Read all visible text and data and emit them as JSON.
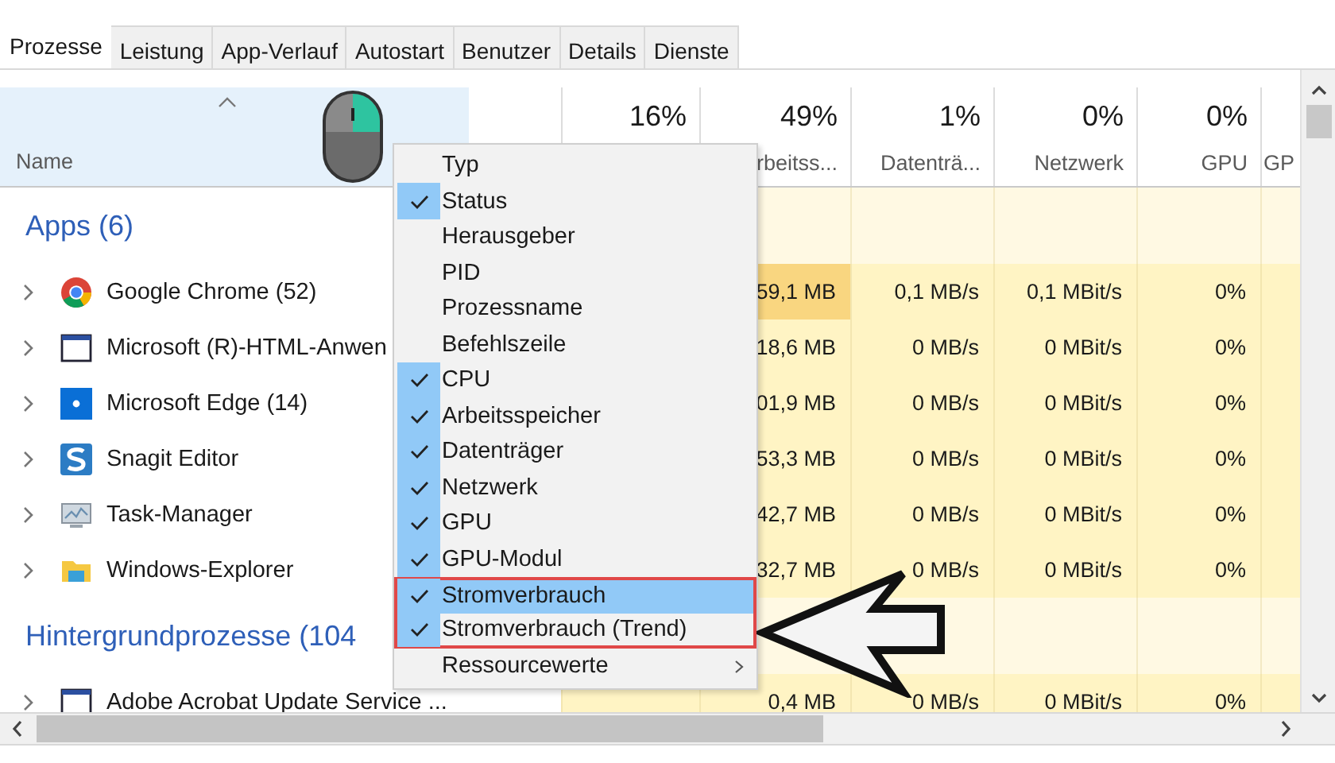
{
  "tabs": [
    {
      "label": "Prozesse",
      "selected": true
    },
    {
      "label": "Leistung",
      "selected": false
    },
    {
      "label": "App-Verlauf",
      "selected": false
    },
    {
      "label": "Autostart",
      "selected": false
    },
    {
      "label": "Benutzer",
      "selected": false
    },
    {
      "label": "Details",
      "selected": false
    },
    {
      "label": "Dienste",
      "selected": false
    }
  ],
  "table": {
    "name_column": {
      "label": "Name",
      "sorted": true
    },
    "columns": [
      {
        "percent": "16%"
      },
      {
        "percent": "49%",
        "label": "rbeitss..."
      },
      {
        "percent": "1%",
        "label": "Datenträ..."
      },
      {
        "percent": "0%",
        "label": "Netzwerk"
      },
      {
        "percent": "0%",
        "label": "GPU"
      },
      {
        "label": "GP"
      }
    ],
    "groups": [
      {
        "title": "Apps (6)",
        "rows": [
          {
            "kind": "chrome",
            "name": "Google Chrome (52)",
            "memory": "59,1 MB",
            "memory_high": true,
            "disk": "0,1 MB/s",
            "network": "0,1 MBit/s",
            "gpu": "0%"
          },
          {
            "kind": "window",
            "name": "Microsoft (R)-HTML-Anwen",
            "memory": "18,6 MB",
            "memory_high": false,
            "disk": "0 MB/s",
            "network": "0 MBit/s",
            "gpu": "0%"
          },
          {
            "kind": "edge",
            "name": "Microsoft Edge (14)",
            "memory": "01,9 MB",
            "memory_high": false,
            "disk": "0 MB/s",
            "network": "0 MBit/s",
            "gpu": "0%"
          },
          {
            "kind": "snagit",
            "name": "Snagit Editor",
            "memory": "53,3 MB",
            "memory_high": false,
            "disk": "0 MB/s",
            "network": "0 MBit/s",
            "gpu": "0%"
          },
          {
            "kind": "monitor",
            "name": "Task-Manager",
            "memory": "42,7 MB",
            "memory_high": false,
            "disk": "0 MB/s",
            "network": "0 MBit/s",
            "gpu": "0%"
          },
          {
            "kind": "folder",
            "name": "Windows-Explorer",
            "memory": "32,7 MB",
            "memory_high": false,
            "disk": "0 MB/s",
            "network": "0 MBit/s",
            "gpu": "0%"
          }
        ]
      },
      {
        "title": "Hintergrundprozesse (104",
        "rows": [
          {
            "kind": "window",
            "name": "Adobe Acrobat Update Service ...",
            "memory": "0,4 MB",
            "memory_high": false,
            "disk": "0 MB/s",
            "network": "0 MBit/s",
            "gpu": "0%"
          }
        ]
      }
    ]
  },
  "context_menu": {
    "items": [
      {
        "label": "Typ",
        "checked": false,
        "selected": false,
        "framed": false
      },
      {
        "label": "Status",
        "checked": true,
        "selected": false,
        "framed": false
      },
      {
        "label": "Herausgeber",
        "checked": false,
        "selected": false,
        "framed": false
      },
      {
        "label": "PID",
        "checked": false,
        "selected": false,
        "framed": false
      },
      {
        "label": "Prozessname",
        "checked": false,
        "selected": false,
        "framed": false
      },
      {
        "label": "Befehlszeile",
        "checked": false,
        "selected": false,
        "framed": false
      },
      {
        "label": "CPU",
        "checked": true,
        "selected": false,
        "framed": false
      },
      {
        "label": "Arbeitsspeicher",
        "checked": true,
        "selected": false,
        "framed": false
      },
      {
        "label": "Datenträger",
        "checked": true,
        "selected": false,
        "framed": false
      },
      {
        "label": "Netzwerk",
        "checked": true,
        "selected": false,
        "framed": false
      },
      {
        "label": "GPU",
        "checked": true,
        "selected": false,
        "framed": false
      },
      {
        "label": "GPU-Modul",
        "checked": true,
        "selected": false,
        "framed": false
      },
      {
        "label": "Stromverbrauch",
        "checked": true,
        "selected": true,
        "framed": true
      },
      {
        "label": "Stromverbrauch (Trend)",
        "checked": true,
        "selected": false,
        "framed": true
      },
      {
        "label": "Ressourcewerte",
        "checked": false,
        "selected": false,
        "framed": false,
        "submenu": true
      }
    ]
  }
}
